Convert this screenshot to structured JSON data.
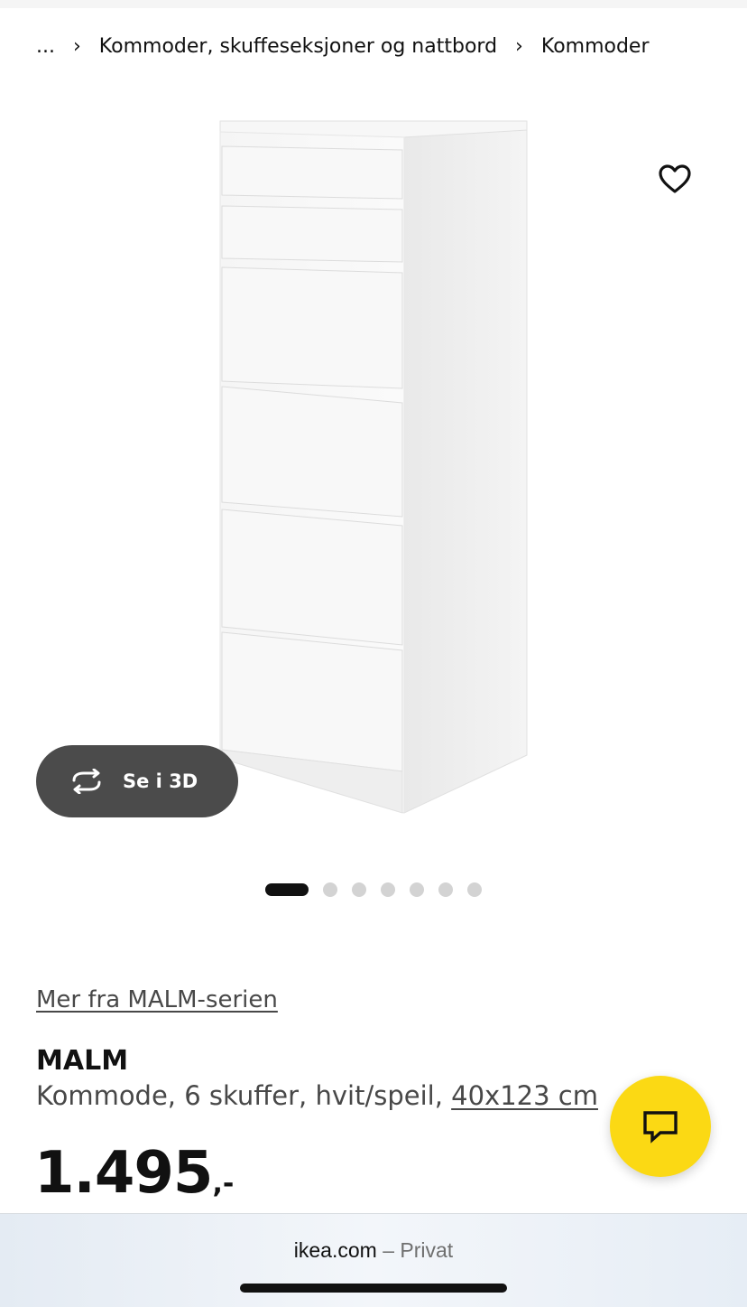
{
  "breadcrumb": {
    "ellipsis": "...",
    "separator": "›",
    "items": [
      "Kommoder, skuffeseksjoner og nattbord",
      "Kommoder"
    ]
  },
  "gallery": {
    "view_3d_label": "Se i 3D",
    "slide_count": 7,
    "active_slide": 1
  },
  "product": {
    "series_link": "Mer fra MALM-serien",
    "name": "MALM",
    "description": "Kommode, 6 skuffer, hvit/speil,",
    "dimensions": "40x123 cm",
    "price": "1.495",
    "price_suffix": ",-"
  },
  "browser": {
    "domain": "ikea.com",
    "mode": "– Privat"
  },
  "colors": {
    "accent_yellow": "#fbd914",
    "dark_pill": "#4b4b4b"
  },
  "icons": {
    "favorite": "heart-outline-icon",
    "rotate_3d": "rotate-arrows-icon",
    "chat": "chat-bubble-icon"
  }
}
